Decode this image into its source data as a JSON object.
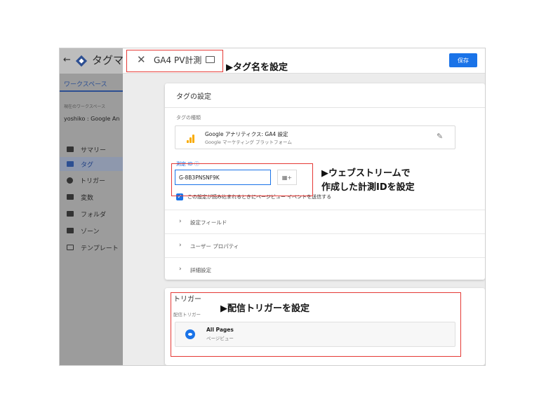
{
  "sidebar": {
    "back_glyph": "←",
    "title": "タグマ",
    "tab": "ワークスペース",
    "workspace_label": "現在のワークスペース",
    "workspace_value": "yoshiko : Google An",
    "items": [
      {
        "label": "サマリー",
        "icon": "summary-icon"
      },
      {
        "label": "タグ",
        "icon": "tag-icon"
      },
      {
        "label": "トリガー",
        "icon": "trigger-icon"
      },
      {
        "label": "変数",
        "icon": "variables-icon"
      },
      {
        "label": "フォルダ",
        "icon": "folder-icon"
      },
      {
        "label": "ゾーン",
        "icon": "zone-icon"
      },
      {
        "label": "テンプレート",
        "icon": "template-icon"
      }
    ],
    "active_item": "タグ"
  },
  "topbar": {
    "close_glyph": "✕",
    "tag_name": "GA4 PV計測",
    "save_label": "保存"
  },
  "config": {
    "title": "タグの設定",
    "type_label": "タグの種類",
    "type_name": "Google アナリティクス: GA4 設定",
    "type_sub": "Google マーケティング プラットフォーム",
    "measurement_label": "測定 ID ⓘ",
    "measurement_id": "G-8B3PNSNF9K",
    "variable_button_icon": "variable-icon",
    "pageview_label": "この設定が読み込まれるときにページビュー イベントを送信する",
    "pageview_checked": true,
    "rows": [
      "設定フィールド",
      "ユーザー プロパティ",
      "詳細設定"
    ]
  },
  "trigger": {
    "title": "トリガー",
    "sub": "配信トリガー",
    "name": "All Pages",
    "type": "ページビュー"
  },
  "annotations": {
    "name_note": "▶タグ名を設定",
    "id_note_line1": "▶ウェブストリームで",
    "id_note_line2": "作成した計測IDを設定",
    "trigger_note": "▶配信トリガーを設定"
  },
  "colors": {
    "accent": "#1a73e8",
    "annotation_border": "#e53935",
    "ga_orange": "#f9ab00"
  }
}
